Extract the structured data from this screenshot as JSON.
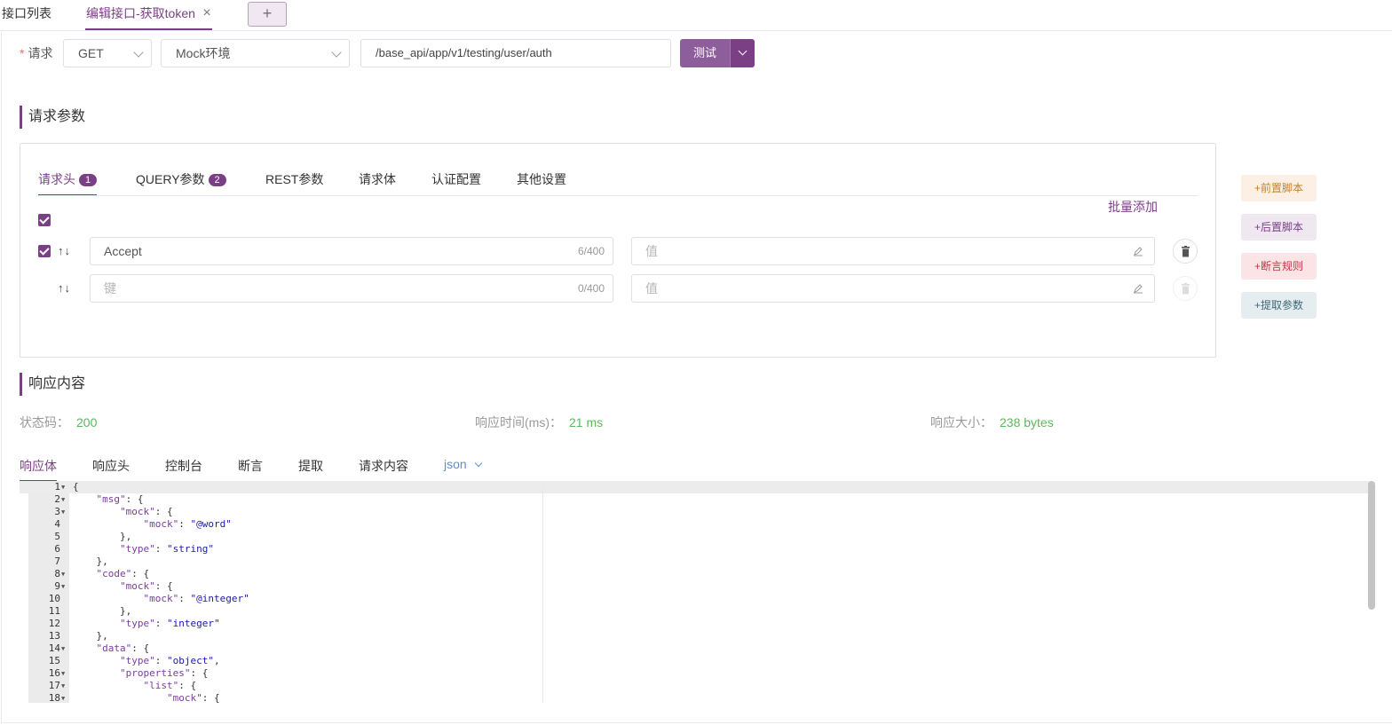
{
  "tabs": {
    "items": [
      {
        "label": "接口列表"
      },
      {
        "label": "编辑接口-获取token"
      }
    ],
    "close_glyph": "×",
    "add_glyph": "+"
  },
  "request": {
    "label": "请求",
    "required_mark": "*",
    "method": "GET",
    "environment": "Mock环境",
    "url": "/base_api/app/v1/testing/user/auth",
    "test_label": "测试"
  },
  "params_section": {
    "title": "请求参数",
    "tabs": [
      {
        "label": "请求头",
        "badge": "1"
      },
      {
        "label": "QUERY参数",
        "badge": "2"
      },
      {
        "label": "REST参数"
      },
      {
        "label": "请求体"
      },
      {
        "label": "认证配置"
      },
      {
        "label": "其他设置"
      }
    ],
    "batch_add": "批量添加",
    "rows": [
      {
        "key": "Accept",
        "key_count": "6/400",
        "value_placeholder": "值"
      },
      {
        "key_placeholder": "键",
        "key_count": "0/400",
        "value_placeholder": "值"
      }
    ],
    "arrows": "↑↓"
  },
  "side_actions": {
    "pre_script": "+前置脚本",
    "post_script": "+后置脚本",
    "assertion": "+断言规则",
    "extract": "+提取参数"
  },
  "response_section": {
    "title": "响应内容",
    "status_label": "状态码：",
    "status_value": "200",
    "time_label": "响应时间(ms)：",
    "time_value": "21 ms",
    "size_label": "响应大小：",
    "size_value": "238 bytes",
    "tabs": [
      "响应体",
      "响应头",
      "控制台",
      "断言",
      "提取",
      "请求内容"
    ],
    "format": "json"
  },
  "editor": {
    "lines": [
      {
        "n": "1",
        "fold": true,
        "text": "{"
      },
      {
        "n": "2",
        "fold": true,
        "text": "    \"msg\": {"
      },
      {
        "n": "3",
        "fold": true,
        "text": "        \"mock\": {"
      },
      {
        "n": "4",
        "fold": false,
        "text": "            \"mock\": \"@word\""
      },
      {
        "n": "5",
        "fold": false,
        "text": "        },"
      },
      {
        "n": "6",
        "fold": false,
        "text": "        \"type\": \"string\""
      },
      {
        "n": "7",
        "fold": false,
        "text": "    },"
      },
      {
        "n": "8",
        "fold": true,
        "text": "    \"code\": {"
      },
      {
        "n": "9",
        "fold": true,
        "text": "        \"mock\": {"
      },
      {
        "n": "10",
        "fold": false,
        "text": "            \"mock\": \"@integer\""
      },
      {
        "n": "11",
        "fold": false,
        "text": "        },"
      },
      {
        "n": "12",
        "fold": false,
        "text": "        \"type\": \"integer\""
      },
      {
        "n": "13",
        "fold": false,
        "text": "    },"
      },
      {
        "n": "14",
        "fold": true,
        "text": "    \"data\": {"
      },
      {
        "n": "15",
        "fold": false,
        "text": "        \"type\": \"object\","
      },
      {
        "n": "16",
        "fold": true,
        "text": "        \"properties\": {"
      },
      {
        "n": "17",
        "fold": true,
        "text": "            \"list\": {"
      },
      {
        "n": "18",
        "fold": true,
        "text": "                \"mock\": {"
      }
    ]
  },
  "colors": {
    "accent": "#7b3f86",
    "success": "#5cb85c",
    "link": "#5b8fd6"
  }
}
